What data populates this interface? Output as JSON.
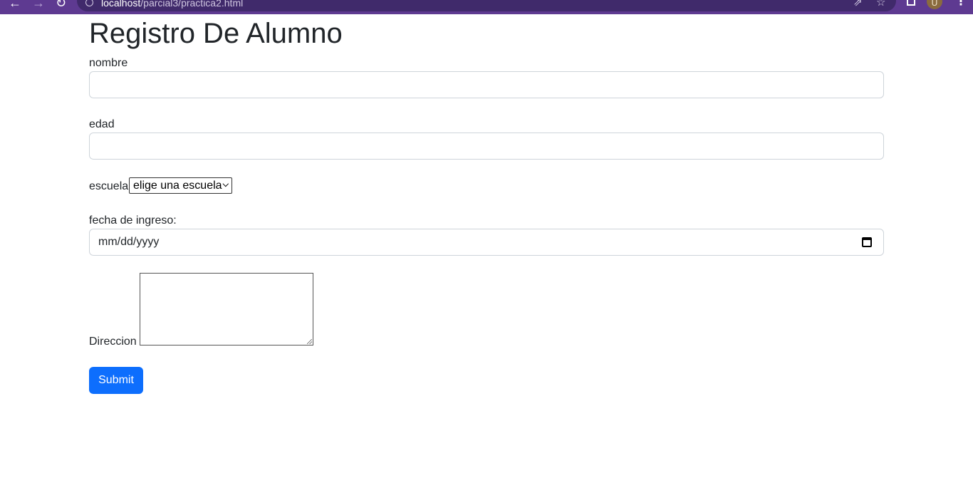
{
  "browser": {
    "back_icon": "←",
    "forward_icon": "→",
    "reload_icon": "↻",
    "url_host": "localhost",
    "url_path": "/parcial3/practica2.html",
    "share_icon": "⇗",
    "star_icon": "☆",
    "profile_initial": "U",
    "menu_icon": "⋮"
  },
  "form": {
    "title": "Registro De Alumno",
    "nombre_label": "nombre",
    "nombre_value": "",
    "edad_label": "edad",
    "edad_value": "",
    "escuela_label": "escuela",
    "escuela_selected": "elige una escuela",
    "fecha_label": "fecha de ingreso:",
    "fecha_placeholder": "mm/dd/yyyy",
    "direccion_label": "Direccion",
    "submit_label": "Submit"
  },
  "colors": {
    "browser_frame": "#5e3a91",
    "primary_button": "#0d6efd",
    "input_border": "#ced4da"
  }
}
